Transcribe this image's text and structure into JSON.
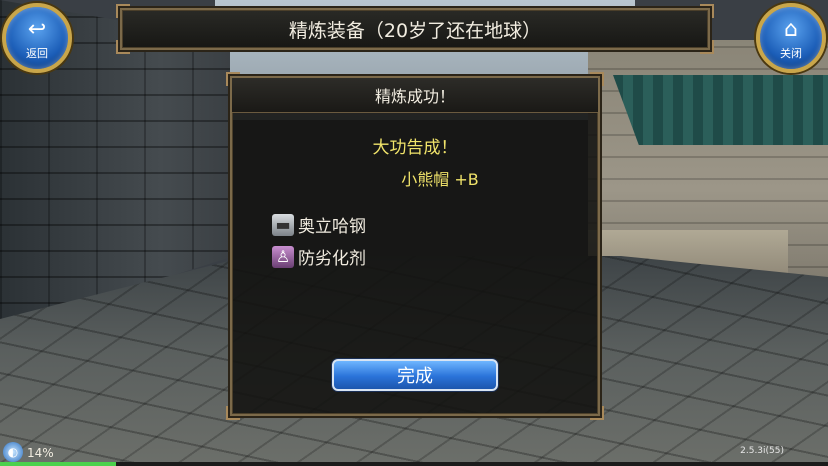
{
  "header": {
    "back_label": "返回",
    "back_icon": "return-arrow-icon",
    "close_label": "关闭",
    "close_icon": "home-icon",
    "title": "精炼装备（20岁了还在地球）"
  },
  "dialog": {
    "title": "精炼成功！",
    "result_title": "大功告成！",
    "result_item": "小熊帽 +B",
    "materials": [
      {
        "name": "奥立哈钢",
        "icon": "ore-icon"
      },
      {
        "name": "防劣化剂",
        "icon": "potion-icon"
      }
    ],
    "done_label": "完成"
  },
  "footer": {
    "status_text": "14%",
    "progress": 0.14,
    "version": "2.5.3i(55)"
  },
  "colors": {
    "accent_gold": "#c9a64a",
    "result_yellow": "#f0e36a",
    "button_blue": "#2a73d9",
    "progress_green": "#4cd14c"
  }
}
